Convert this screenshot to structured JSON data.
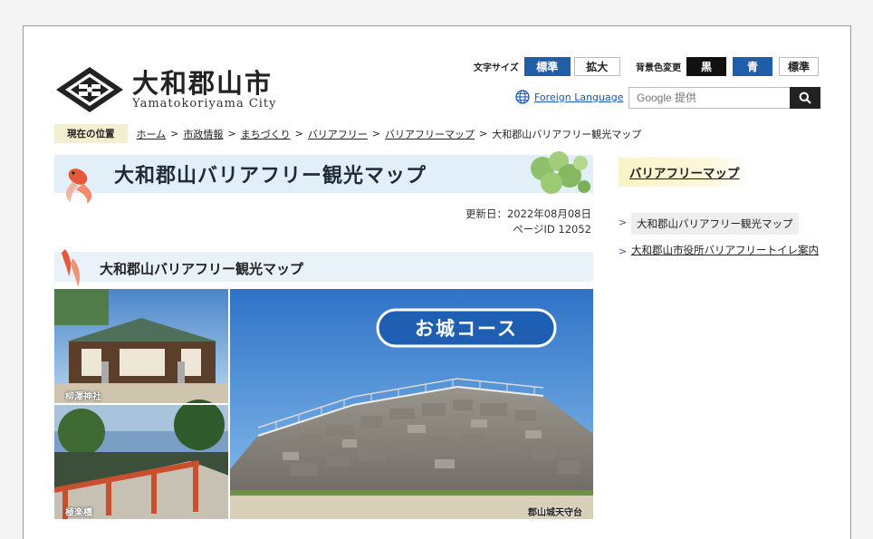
{
  "site": {
    "name_jp": "大和郡山市",
    "name_en": "Yamatokoriyama City"
  },
  "header": {
    "font_size_label": "文字サイズ",
    "font_size_options": [
      "標準",
      "拡大"
    ],
    "bg_color_label": "背景色変更",
    "bg_color_options": [
      "黒",
      "青",
      "標準"
    ],
    "foreign_language": "Foreign Language",
    "search_placeholder": "Google 提供"
  },
  "breadcrumb": {
    "here_label": "現在の位置",
    "items": [
      "ホーム",
      "市政情報",
      "まちづくり",
      "バリアフリー",
      "バリアフリーマップ"
    ],
    "current": "大和郡山バリアフリー観光マップ"
  },
  "main": {
    "title": "大和郡山バリアフリー観光マップ",
    "updated": "更新日：2022年08月08日",
    "page_id": "ページID 12052",
    "section_title": "大和郡山バリアフリー観光マップ",
    "hero": {
      "course_label": "お城コース",
      "caption_shrine": "柳澤神社",
      "caption_bridge": "極楽橋",
      "caption_castle": "郡山城天守台"
    }
  },
  "sidebar": {
    "heading": "バリアフリーマップ",
    "items": [
      {
        "label": "大和郡山バリアフリー観光マップ"
      },
      {
        "label": "大和郡山市役所バリアフリートイレ案内"
      }
    ]
  },
  "colors": {
    "accent_blue": "#1e5fa8",
    "dark": "#111111",
    "link_blue": "#1a56b8"
  }
}
